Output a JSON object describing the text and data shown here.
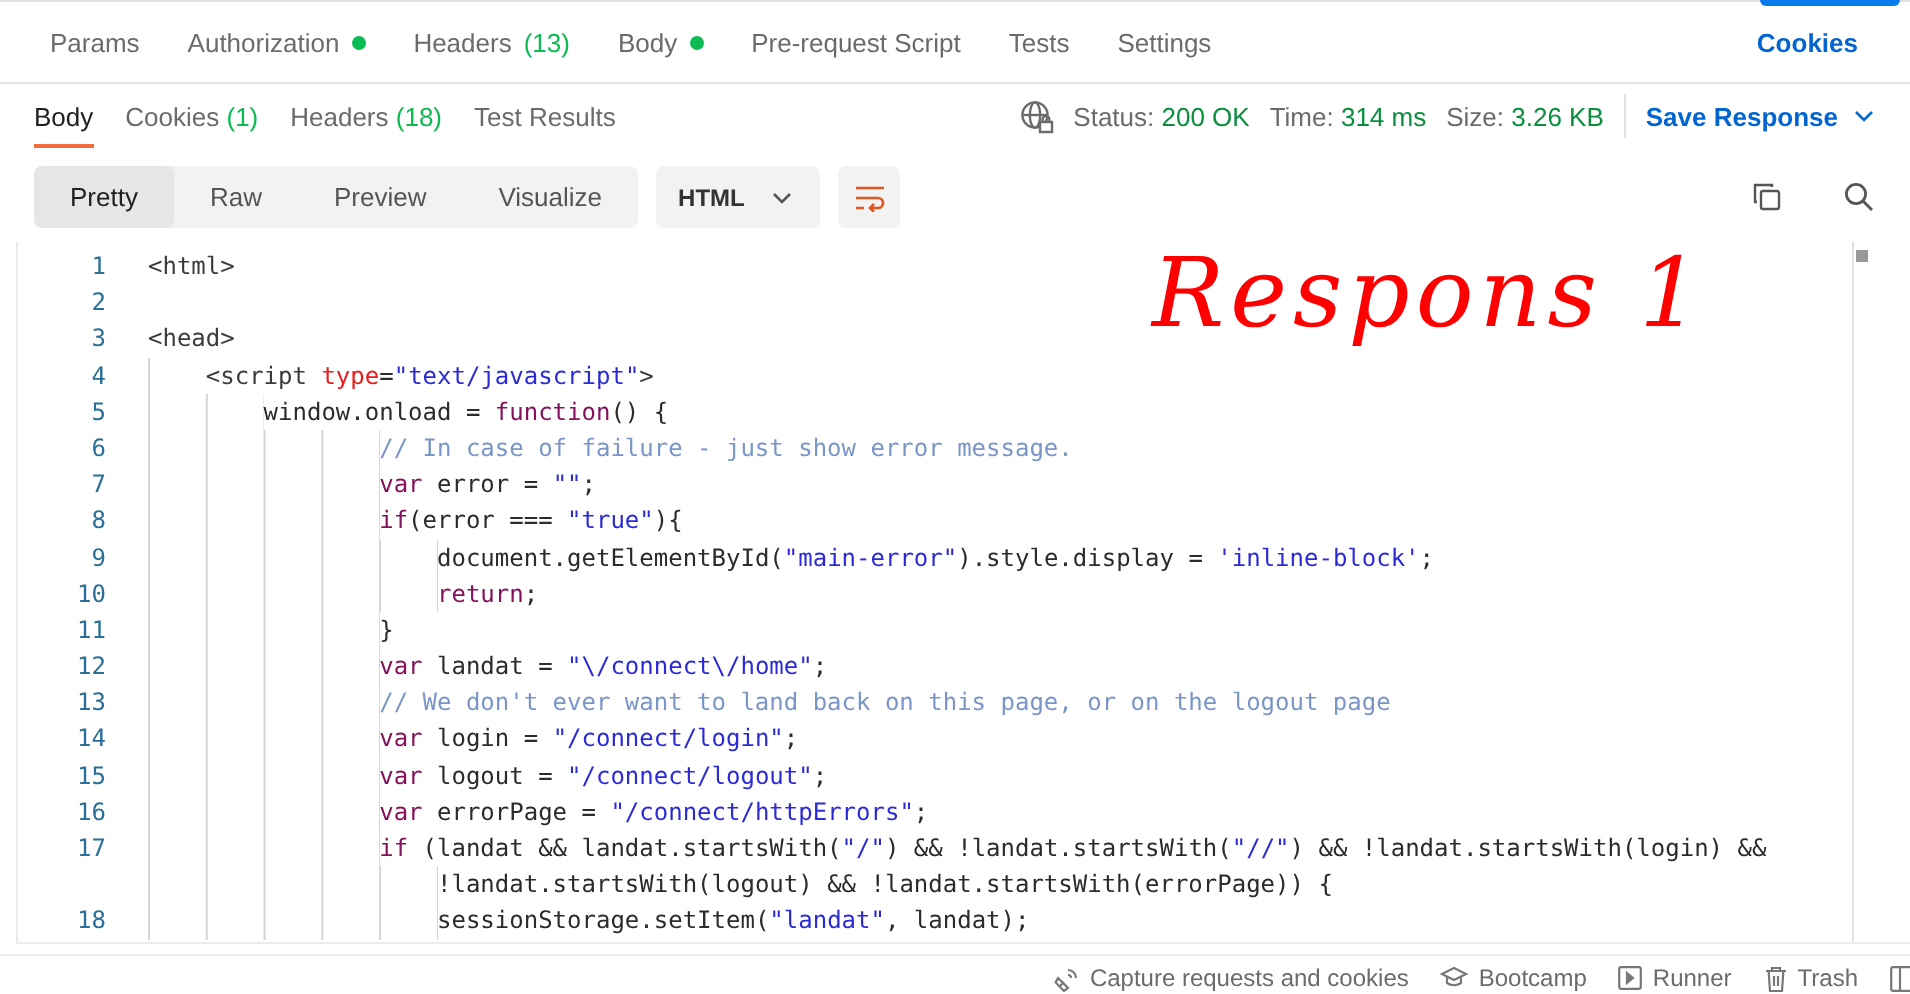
{
  "request_tabs": [
    {
      "label": "Params",
      "dot": false,
      "selected": false
    },
    {
      "label": "Authorization",
      "dot": true,
      "selected": false
    },
    {
      "label": "Headers",
      "count": "(13)",
      "dot": false,
      "selected": false
    },
    {
      "label": "Body",
      "dot": true,
      "selected": false
    },
    {
      "label": "Pre-request Script",
      "dot": false,
      "selected": false
    },
    {
      "label": "Tests",
      "dot": false,
      "selected": false
    },
    {
      "label": "Settings",
      "dot": false,
      "selected": false
    }
  ],
  "cookies_link": "Cookies",
  "response_tabs": [
    {
      "label": "Body",
      "selected": true
    },
    {
      "label": "Cookies",
      "count": "(1)",
      "selected": false
    },
    {
      "label": "Headers",
      "count": "(18)",
      "selected": false
    },
    {
      "label": "Test Results",
      "selected": false
    }
  ],
  "response_stats": [
    {
      "label": "Status:",
      "value": "200 OK"
    },
    {
      "label": "Time:",
      "value": "314 ms"
    },
    {
      "label": "Size:",
      "value": "3.26 KB"
    }
  ],
  "save_response": "Save Response",
  "view_modes": [
    {
      "label": "Pretty",
      "selected": true
    },
    {
      "label": "Raw",
      "selected": false
    },
    {
      "label": "Preview",
      "selected": false
    },
    {
      "label": "Visualize",
      "selected": false
    }
  ],
  "format_dropdown": "HTML",
  "code_lines": [
    {
      "number": "1",
      "tokens": [
        {
          "kind": "tag",
          "text": "<html>"
        }
      ]
    },
    {
      "number": "2"
    },
    {
      "number": "3",
      "tokens": [
        {
          "kind": "tag",
          "text": "<head>"
        }
      ]
    },
    {
      "number": "4",
      "tokens": [
        {
          "kind": "tag",
          "text": "    <script "
        },
        {
          "kind": "attr",
          "text": "type"
        },
        {
          "kind": "plain",
          "text": "="
        },
        {
          "kind": "string",
          "text": "\"text/javascript\""
        },
        {
          "kind": "tag",
          "text": ">"
        }
      ]
    },
    {
      "number": "5",
      "tokens": [
        {
          "kind": "plain",
          "text": "        window.onload = "
        },
        {
          "kind": "keyword",
          "text": "function"
        },
        {
          "kind": "plain",
          "text": "() {"
        }
      ]
    },
    {
      "number": "6",
      "tokens": [
        {
          "kind": "comment",
          "text": "                // In case of failure - just show error message."
        }
      ]
    },
    {
      "number": "7",
      "tokens": [
        {
          "kind": "keyword",
          "text": "                var"
        },
        {
          "kind": "plain",
          "text": " error = "
        },
        {
          "kind": "string",
          "text": "\"\""
        },
        {
          "kind": "plain",
          "text": ";"
        }
      ]
    },
    {
      "number": "8",
      "tokens": [
        {
          "kind": "keyword",
          "text": "                if"
        },
        {
          "kind": "plain",
          "text": "(error === "
        },
        {
          "kind": "string",
          "text": "\"true\""
        },
        {
          "kind": "plain",
          "text": "){"
        }
      ]
    },
    {
      "number": "9",
      "tokens": [
        {
          "kind": "plain",
          "text": "                    document.getElementById("
        },
        {
          "kind": "string",
          "text": "\"main-error\""
        },
        {
          "kind": "plain",
          "text": ").style.display = "
        },
        {
          "kind": "string",
          "text": "'inline-block'"
        },
        {
          "kind": "plain",
          "text": ";"
        }
      ]
    },
    {
      "number": "10",
      "tokens": [
        {
          "kind": "keyword",
          "text": "                    return"
        },
        {
          "kind": "plain",
          "text": ";"
        }
      ]
    },
    {
      "number": "11",
      "tokens": [
        {
          "kind": "plain",
          "text": "                }"
        }
      ]
    },
    {
      "number": "12",
      "tokens": [
        {
          "kind": "keyword",
          "text": "                var"
        },
        {
          "kind": "plain",
          "text": " landat = "
        },
        {
          "kind": "string",
          "text": "\"\\/connect\\/home\""
        },
        {
          "kind": "plain",
          "text": ";"
        }
      ]
    },
    {
      "number": "13",
      "tokens": [
        {
          "kind": "comment",
          "text": "                // We don't ever want to land back on this page, or on the logout page"
        }
      ]
    },
    {
      "number": "14",
      "tokens": [
        {
          "kind": "keyword",
          "text": "                var"
        },
        {
          "kind": "plain",
          "text": " login = "
        },
        {
          "kind": "string",
          "text": "\"/connect/login\""
        },
        {
          "kind": "plain",
          "text": ";"
        }
      ]
    },
    {
      "number": "15",
      "tokens": [
        {
          "kind": "keyword",
          "text": "                var"
        },
        {
          "kind": "plain",
          "text": " logout = "
        },
        {
          "kind": "string",
          "text": "\"/connect/logout\""
        },
        {
          "kind": "plain",
          "text": ";"
        }
      ]
    },
    {
      "number": "16",
      "tokens": [
        {
          "kind": "keyword",
          "text": "                var"
        },
        {
          "kind": "plain",
          "text": " errorPage = "
        },
        {
          "kind": "string",
          "text": "\"/connect/httpErrors\""
        },
        {
          "kind": "plain",
          "text": ";"
        }
      ]
    },
    {
      "number": "17",
      "tokens": [
        {
          "kind": "keyword",
          "text": "                if"
        },
        {
          "kind": "plain",
          "text": " (landat && landat.startsWith("
        },
        {
          "kind": "string",
          "text": "\"/\""
        },
        {
          "kind": "plain",
          "text": ") && !landat.startsWith("
        },
        {
          "kind": "string",
          "text": "\"//\""
        },
        {
          "kind": "plain",
          "text": ") && !landat.startsWith(login) &&"
        }
      ]
    },
    {
      "tokens": [
        {
          "kind": "plain",
          "text": "                    !landat.startsWith(logout) && !landat.startsWith(errorPage)) {"
        }
      ]
    },
    {
      "number": "18",
      "tokens": [
        {
          "kind": "plain",
          "text": "                    sessionStorage.setItem("
        },
        {
          "kind": "string",
          "text": "\"landat\""
        },
        {
          "kind": "plain",
          "text": ", landat);"
        }
      ]
    }
  ],
  "annotation": "Respons 1",
  "footer_items": [
    {
      "kind": "capture",
      "label": "Capture requests and cookies"
    },
    {
      "kind": "bootcamp",
      "label": "Bootcamp"
    },
    {
      "kind": "runner",
      "label": "Runner"
    },
    {
      "kind": "trash",
      "label": "Trash"
    }
  ]
}
